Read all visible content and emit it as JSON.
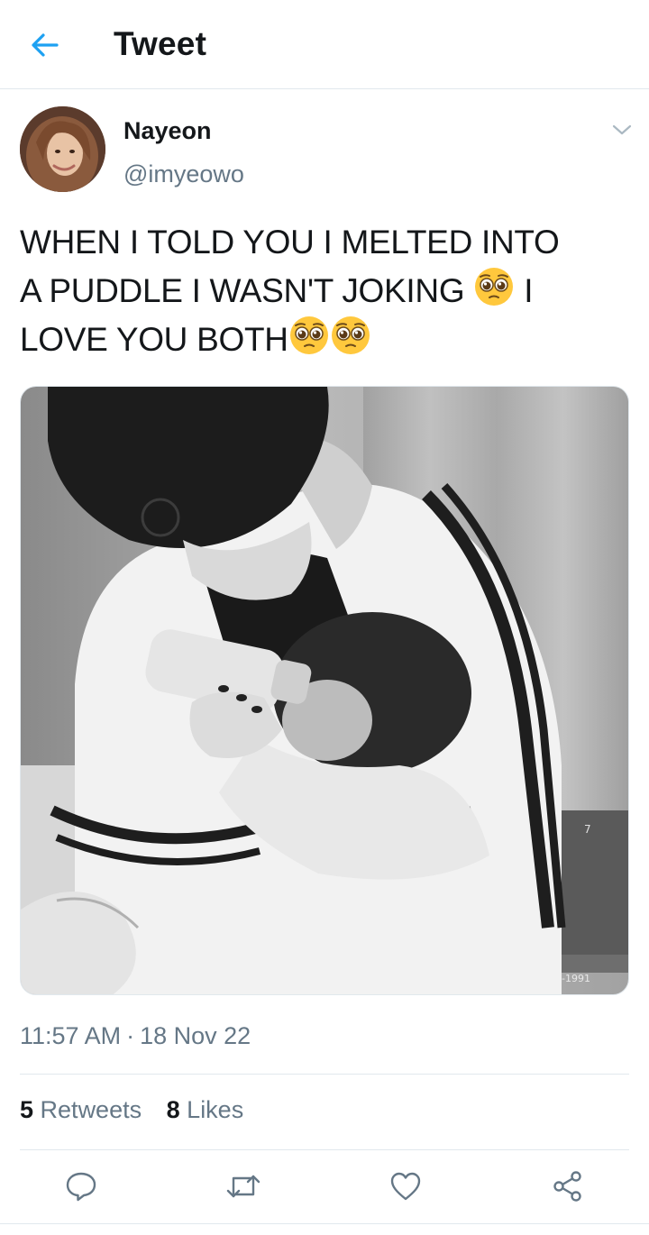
{
  "header": {
    "title": "Tweet",
    "back_icon": "arrow-left-icon"
  },
  "colors": {
    "accent": "#1da1f2",
    "text": "#14171a",
    "muted": "#657786",
    "border": "#e1e8ed",
    "emoji": "#ffc83d"
  },
  "author": {
    "name": "Nayeon",
    "handle": "@imyeowo",
    "menu_icon": "chevron-down-icon"
  },
  "tweet": {
    "lines": [
      "WHEN I TOLD YOU I MELTED INTO",
      "A PUDDLE  I WASN'T JOKING",
      "I",
      "LOVE YOU BOTH"
    ],
    "emoji": "pleading-face-emoji"
  },
  "media": {
    "kind": "photo",
    "style": "black-and-white"
  },
  "meta": {
    "time": "11:57 AM",
    "separator": "·",
    "date": "18 Nov 22"
  },
  "stats": {
    "retweets_count": "5",
    "retweets_label": "Retweets",
    "likes_count": "8",
    "likes_label": "Likes"
  },
  "actions": [
    {
      "icon": "reply-icon"
    },
    {
      "icon": "retweet-icon"
    },
    {
      "icon": "like-icon"
    },
    {
      "icon": "share-icon"
    }
  ]
}
